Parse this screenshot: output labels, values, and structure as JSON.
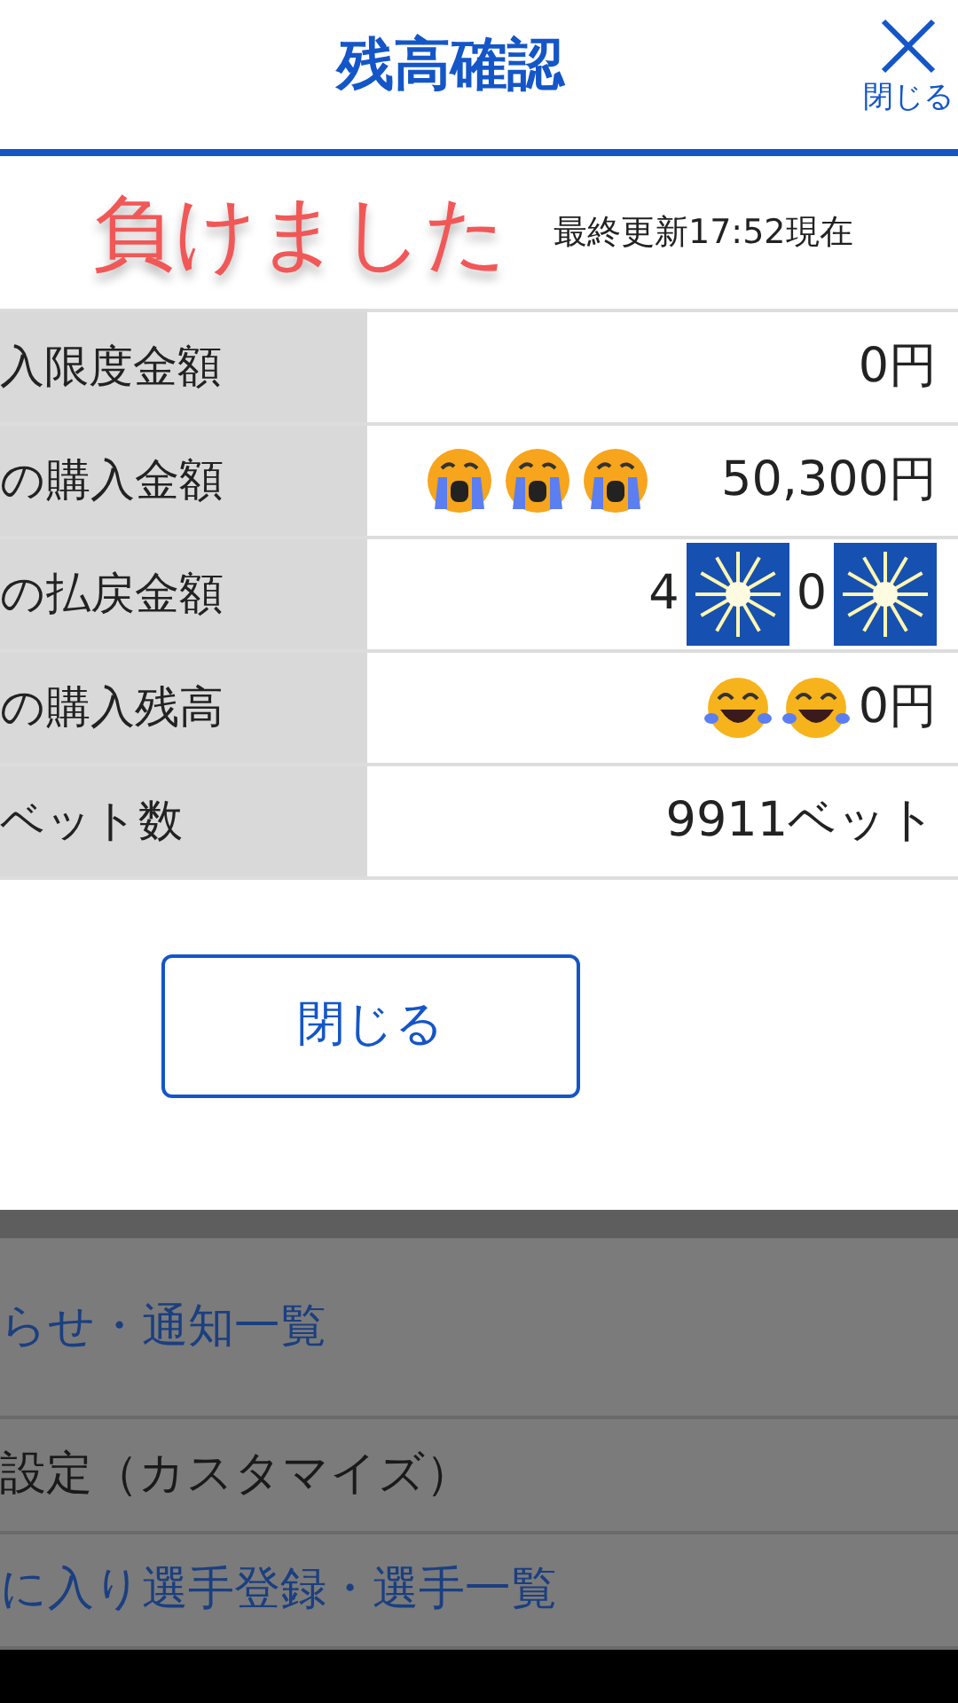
{
  "dialog": {
    "title": "残高確認",
    "close_label": "閉じる",
    "result": "負けました",
    "updated": "最終更新17:52現在",
    "rows": [
      {
        "label": "入限度金額",
        "parts": [
          {
            "kind": "text",
            "text": "0円"
          }
        ]
      },
      {
        "label": "の購入金額",
        "parts": [
          {
            "kind": "crying"
          },
          {
            "kind": "crying"
          },
          {
            "kind": "crying"
          },
          {
            "kind": "gap"
          },
          {
            "kind": "text",
            "text": "50,300円"
          }
        ]
      },
      {
        "label": "の払戻金額",
        "parts": [
          {
            "kind": "text",
            "text": "4"
          },
          {
            "kind": "firework"
          },
          {
            "kind": "text",
            "text": "0"
          },
          {
            "kind": "firework"
          }
        ]
      },
      {
        "label": "の購入残高",
        "parts": [
          {
            "kind": "laughing"
          },
          {
            "kind": "laughing"
          },
          {
            "kind": "text",
            "text": "0円"
          }
        ]
      },
      {
        "label": "ベット数",
        "parts": [
          {
            "kind": "text",
            "text": "9911ベット"
          }
        ]
      }
    ],
    "button": "閉じる"
  },
  "menu": [
    {
      "kind": "link",
      "text": "らせ・通知一覧"
    },
    {
      "kind": "plain",
      "text": "設定（カスタマイズ）"
    },
    {
      "kind": "link",
      "text": "に入り選手登録・選手一覧"
    }
  ]
}
